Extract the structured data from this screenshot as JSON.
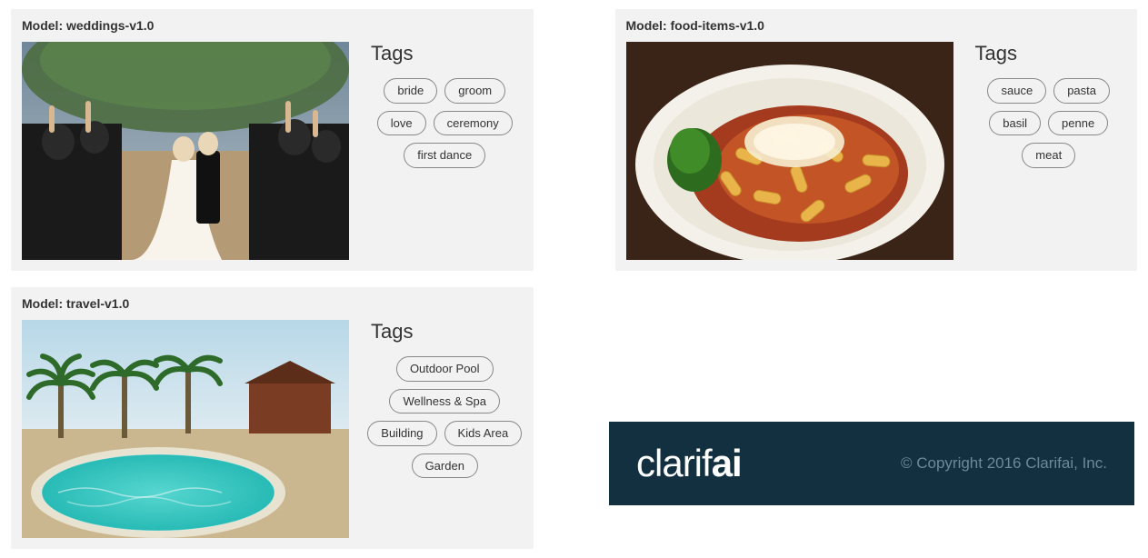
{
  "cards": [
    {
      "model_label": "Model: weddings-v1.0",
      "tags_heading": "Tags",
      "tags": [
        "bride",
        "groom",
        "love",
        "ceremony",
        "first dance"
      ]
    },
    {
      "model_label": "Model: food-items-v1.0",
      "tags_heading": "Tags",
      "tags": [
        "sauce",
        "pasta",
        "basil",
        "penne",
        "meat"
      ]
    },
    {
      "model_label": "Model: travel-v1.0",
      "tags_heading": "Tags",
      "tags": [
        "Outdoor Pool",
        "Wellness & Spa",
        "Building",
        "Kids Area",
        "Garden"
      ]
    }
  ],
  "footer": {
    "logo_text_a": "clarif",
    "logo_text_b": "ai",
    "copyright": "© Copyright 2016 Clarifai, Inc."
  }
}
